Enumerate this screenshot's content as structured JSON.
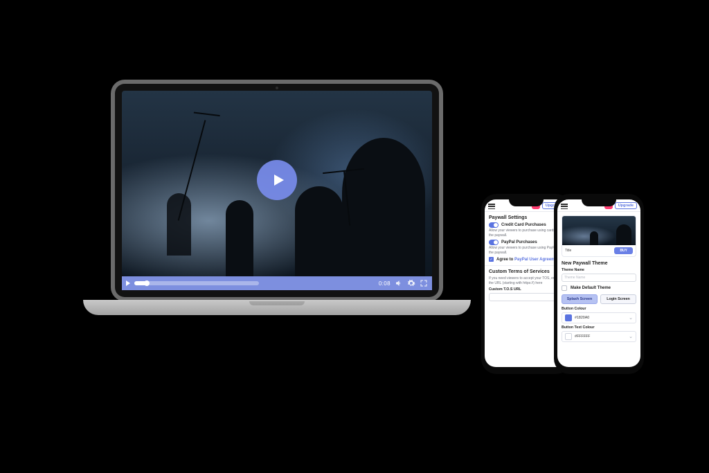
{
  "video": {
    "timecode": "0:08",
    "progress_percent": 10
  },
  "phone1": {
    "header_upgrade": "Upgrade",
    "settings_title": "Paywall Settings",
    "cc_label": "Credit Card Purchases",
    "cc_sub": "Allow your viewers to purchase using cards on the paywall.",
    "pp_label": "PayPal Purchases",
    "pp_sub": "Allow your viewers to purchase using PayPal on the paywall.",
    "agree_prefix": "Agree to ",
    "agree_link": "PayPal User Agreement",
    "tos_title": "Custom Terms of Services",
    "tos_sub": "If you need viewers to accept your TOS, enter the URL (starting with https://) here",
    "tos_field_label": "Custom T.O.S URL",
    "tos_placeholder": ""
  },
  "phone2": {
    "header_upgrade": "Upgrade",
    "thumb_title": "Title",
    "thumb_button": "BUY",
    "section_title": "New Paywall Theme",
    "theme_name_label": "Theme Name",
    "theme_name_placeholder": "Theme Name",
    "default_label": "Make Default Theme",
    "tab_splash": "Splash Screen",
    "tab_login": "Login Screen",
    "button_colour_label": "Button Colour",
    "button_colour_value": "#1820A0",
    "button_text_colour_label": "Button Text Colour",
    "button_text_colour_value": "#FFFFFF"
  }
}
